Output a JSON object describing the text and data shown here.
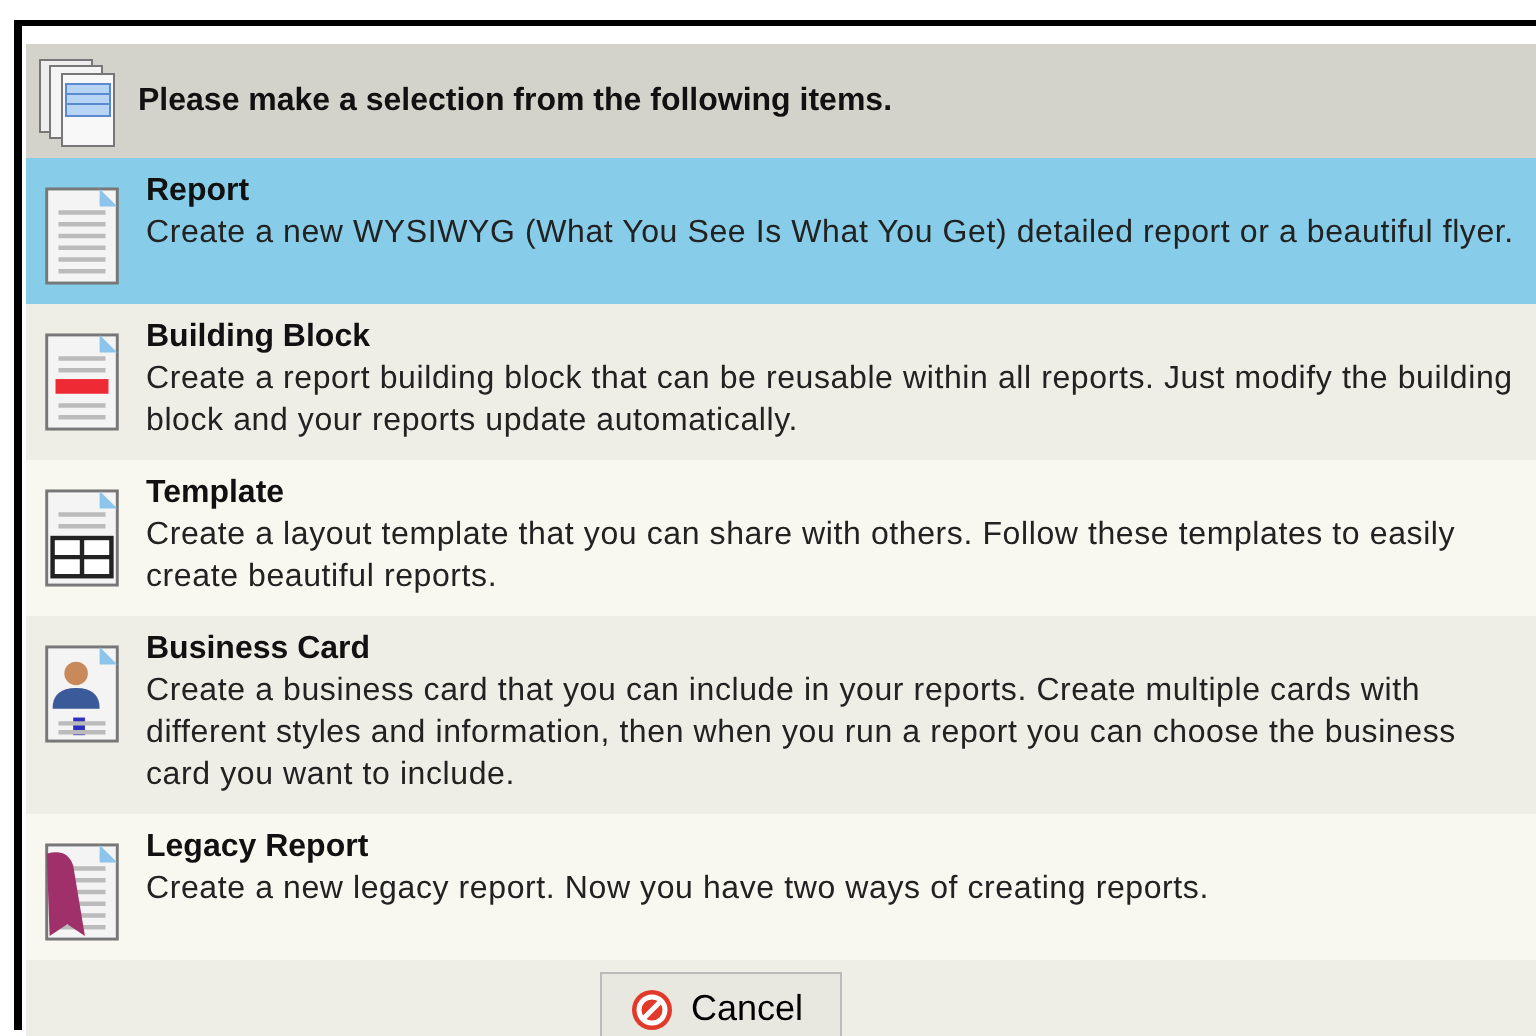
{
  "header": {
    "title": "Please make a selection from the following items."
  },
  "items": [
    {
      "kind": "report",
      "title": "Report",
      "description": "Create a new WYSIWYG (What You See Is What You Get) detailed report or a beautiful flyer.",
      "selected": true
    },
    {
      "kind": "block",
      "title": "Building Block",
      "description": "Create a report building block that can be reusable within all reports. Just modify the building block and your reports update automatically.",
      "selected": false
    },
    {
      "kind": "template",
      "title": "Template",
      "description": "Create a layout template that you can share with others. Follow these templates to easily create beautiful reports.",
      "selected": false
    },
    {
      "kind": "card",
      "title": "Business Card",
      "description": "Create a business card that you can include in your reports. Create multiple cards with different styles and information, then when you run a report you can choose the business card you want to include.",
      "selected": false
    },
    {
      "kind": "legacy",
      "title": "Legacy Report",
      "description": "Create a new legacy report. Now you have two ways of creating reports.",
      "selected": false
    }
  ],
  "buttons": [
    {
      "label": "Cancel"
    }
  ]
}
